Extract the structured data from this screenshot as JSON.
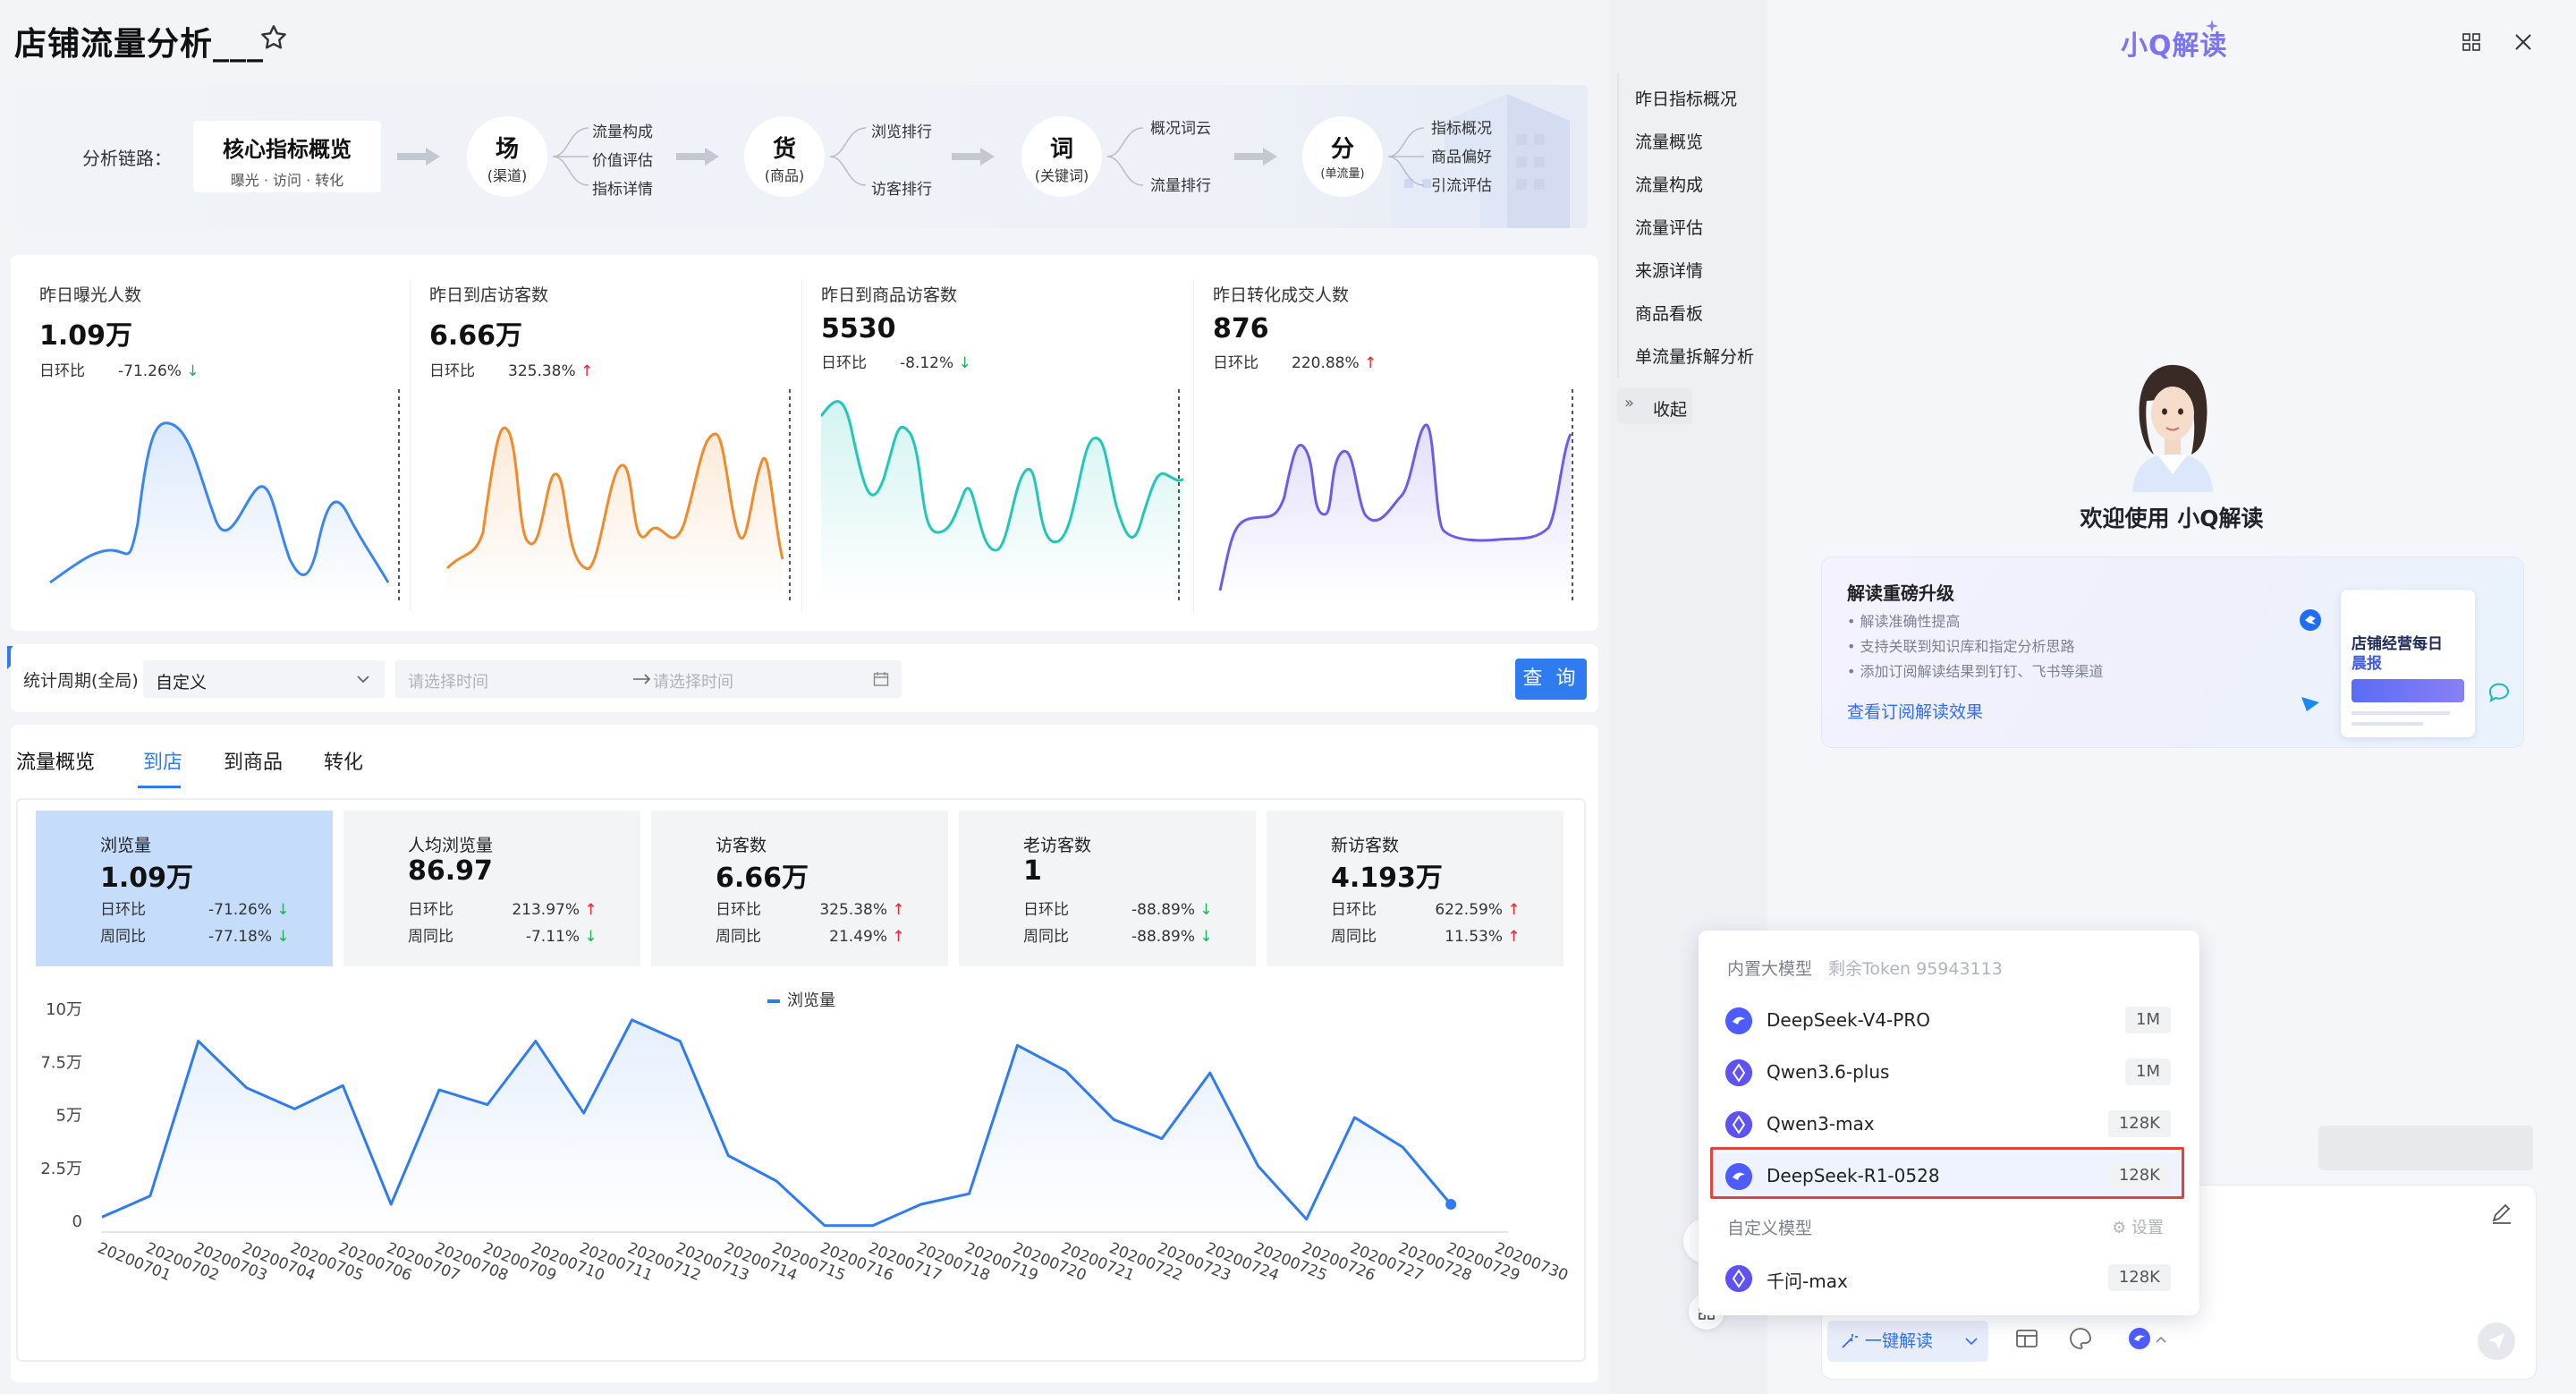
{
  "header": {
    "title": "店铺流量分析___"
  },
  "chain": {
    "label": "分析链路：",
    "core": {
      "title": "核心指标概览",
      "sub": "曝光 · 访问 · 转化"
    },
    "nodes": [
      {
        "title": "场",
        "sub": "(渠道)",
        "items": [
          "流量构成",
          "价值评估",
          "指标详情"
        ]
      },
      {
        "title": "货",
        "sub": "(商品)",
        "items": [
          "浏览排行",
          "访客排行"
        ]
      },
      {
        "title": "词",
        "sub": "(关键词)",
        "items": [
          "概况词云",
          "流量排行"
        ]
      },
      {
        "title": "分",
        "sub": "(单流量)",
        "items": [
          "指标概况",
          "商品偏好",
          "引流评估"
        ]
      }
    ]
  },
  "metrics": [
    {
      "title": "昨日曝光人数",
      "value": "1.09万",
      "cmp_label": "日环比",
      "cmp": "-71.26%",
      "dir": "down",
      "color": "#3a86f0"
    },
    {
      "title": "昨日到店访客数",
      "value": "6.66万",
      "cmp_label": "日环比",
      "cmp": "325.38%",
      "dir": "up",
      "color": "#f08a2a"
    },
    {
      "title": "昨日到商品访客数",
      "value": "5530",
      "cmp_label": "日环比",
      "cmp": "-8.12%",
      "dir": "down",
      "color": "#22c7b8"
    },
    {
      "title": "昨日转化成交人数",
      "value": "876",
      "cmp_label": "日环比",
      "cmp": "220.88%",
      "dir": "up",
      "color": "#6e5ce8"
    }
  ],
  "filter": {
    "label": "统计周期(全局)",
    "select": "自定义",
    "start_placeholder": "请选择时间",
    "end_placeholder": "请选择时间",
    "query": "查 询"
  },
  "flow": {
    "tabs": [
      "流量概览",
      "到店",
      "到商品",
      "转化"
    ],
    "active_tab": 1,
    "kpis": [
      {
        "title": "浏览量",
        "value": "1.09万",
        "r1l": "日环比",
        "r1": "-71.26%",
        "d1": "down",
        "r2l": "周同比",
        "r2": "-77.18%",
        "d2": "down"
      },
      {
        "title": "人均浏览量",
        "value": "86.97",
        "r1l": "日环比",
        "r1": "213.97%",
        "d1": "up",
        "r2l": "周同比",
        "r2": "-7.11%",
        "d2": "down"
      },
      {
        "title": "访客数",
        "value": "6.66万",
        "r1l": "日环比",
        "r1": "325.38%",
        "d1": "up",
        "r2l": "周同比",
        "r2": "21.49%",
        "d2": "up"
      },
      {
        "title": "老访客数",
        "value": "1",
        "r1l": "日环比",
        "r1": "-88.89%",
        "d1": "down",
        "r2l": "周同比",
        "r2": "-88.89%",
        "d2": "down"
      },
      {
        "title": "新访客数",
        "value": "4.193万",
        "r1l": "日环比",
        "r1": "622.59%",
        "d1": "up",
        "r2l": "周同比",
        "r2": "11.53%",
        "d2": "up"
      }
    ],
    "legend": "浏览量"
  },
  "chart_data": {
    "type": "area",
    "series": [
      {
        "name": "浏览量",
        "values": [
          0.2,
          1.2,
          8.5,
          6.3,
          5.3,
          6.4,
          0.8,
          6.2,
          5.5,
          8.5,
          5.1,
          9.5,
          8.5,
          3.1,
          1.9,
          -0.2,
          -0.2,
          0.8,
          1.3,
          8.3,
          7.1,
          4.8,
          3.9,
          7.0,
          2.6,
          0.1,
          4.9,
          3.5,
          0.8
        ],
        "color": "#2f7bf0"
      }
    ],
    "x": [
      "20200701",
      "20200702",
      "20200703",
      "20200704",
      "20200705",
      "20200706",
      "20200707",
      "20200708",
      "20200709",
      "20200710",
      "20200711",
      "20200712",
      "20200713",
      "20200714",
      "20200715",
      "20200716",
      "20200717",
      "20200718",
      "20200719",
      "20200720",
      "20200721",
      "20200722",
      "20200723",
      "20200724",
      "20200725",
      "20200726",
      "20200727",
      "20200728",
      "20200729",
      "20200730"
    ],
    "y_ticks": [
      "10万",
      "7.5万",
      "5万",
      "2.5万",
      "0"
    ],
    "ylim": [
      0,
      10
    ],
    "grid": false
  },
  "nav": {
    "items": [
      "昨日指标概况",
      "流量概览",
      "流量构成",
      "流量评估",
      "来源详情",
      "商品看板",
      "单流量拆解分析"
    ],
    "collapse": "收起"
  },
  "panel": {
    "title": "小Q解读",
    "welcome": "欢迎使用 小Q解读",
    "promo": {
      "heading": "解读重磅升级",
      "bullets": [
        "解读准确性提高",
        "支持关联到知识库和指定分析思路",
        "添加订阅解读结果到钉钉、飞书等渠道"
      ],
      "link": "查看订阅解读效果",
      "card_title": "店铺经营每日",
      "card_sub": "晨报"
    },
    "dropdown": {
      "builtin_label": "内置大模型",
      "token_label": "剩余Token 95943113",
      "builtin": [
        {
          "name": "DeepSeek-V4-PRO",
          "tokens": "1M"
        },
        {
          "name": "Qwen3.6-plus",
          "tokens": "1M"
        },
        {
          "name": "Qwen3-max",
          "tokens": "128K"
        },
        {
          "name": "DeepSeek-R1-0528",
          "tokens": "128K"
        }
      ],
      "custom_label": "自定义模型",
      "settings": "设置",
      "custom": [
        {
          "name": "千问-max",
          "tokens": "128K"
        }
      ]
    },
    "ask_button": "一键解读"
  }
}
